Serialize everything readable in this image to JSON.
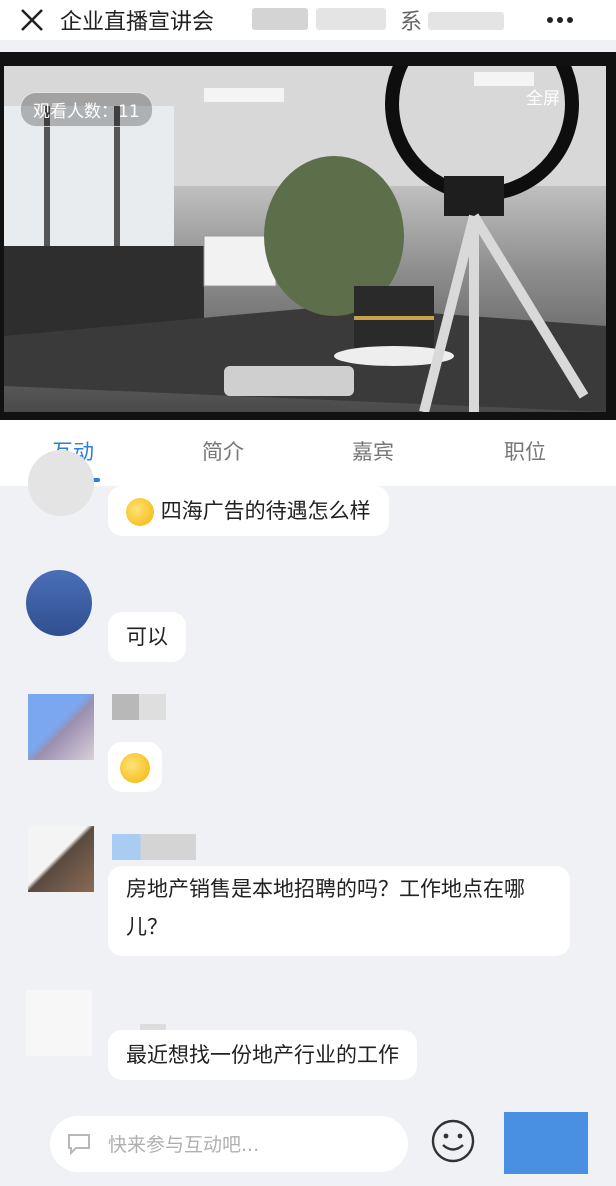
{
  "header": {
    "title": "企业直播宣讲会",
    "title_suffix": "系"
  },
  "video": {
    "viewer_label": "观看人数：11",
    "fullscreen_label": "全屏"
  },
  "tabs": [
    {
      "label": "互动"
    },
    {
      "label": "简介"
    },
    {
      "label": "嘉宾"
    },
    {
      "label": "职位"
    }
  ],
  "messages": [
    {
      "text": "四海广告的待遇怎么样",
      "has_emoji": true
    },
    {
      "text": "可以"
    },
    {
      "text": "",
      "emoji_only": true
    },
    {
      "text": "房地产销售是本地招聘的吗？工作地点在哪儿？"
    },
    {
      "text": "最近想找一份地产行业的工作"
    }
  ],
  "input": {
    "placeholder": "快来参与互动吧..."
  },
  "colors": {
    "accent": "#2b7de1",
    "background": "#f0f1f4"
  },
  "icons": [
    "close-icon",
    "more-icon",
    "chat-icon",
    "smiley-icon",
    "emoji-icon"
  ]
}
